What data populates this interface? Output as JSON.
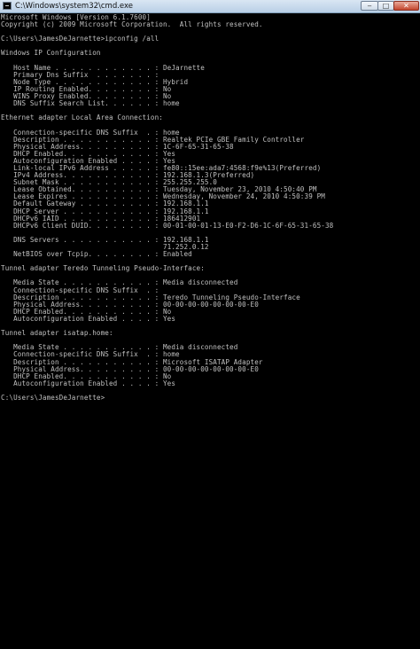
{
  "window": {
    "title": "C:\\Windows\\system32\\cmd.exe",
    "minimize_glyph": "‒",
    "maximize_glyph": "□",
    "close_glyph": "✕",
    "icon": "cmd-icon",
    "colors": {
      "background": "#000000",
      "text": "#c0c0c0",
      "close_button": "#c4472f"
    }
  },
  "console": {
    "lines": [
      "Microsoft Windows [Version 6.1.7600]",
      "Copyright (c) 2009 Microsoft Corporation.  All rights reserved.",
      "",
      "C:\\Users\\JamesDeJarnette>ipconfig /all",
      "",
      "Windows IP Configuration",
      "",
      "   Host Name . . . . . . . . . . . . : DeJarnette",
      "   Primary Dns Suffix  . . . . . . . :",
      "   Node Type . . . . . . . . . . . . : Hybrid",
      "   IP Routing Enabled. . . . . . . . : No",
      "   WINS Proxy Enabled. . . . . . . . : No",
      "   DNS Suffix Search List. . . . . . : home",
      "",
      "Ethernet adapter Local Area Connection:",
      "",
      "   Connection-specific DNS Suffix  . : home",
      "   Description . . . . . . . . . . . : Realtek PCIe GBE Family Controller",
      "   Physical Address. . . . . . . . . : 1C-6F-65-31-65-38",
      "   DHCP Enabled. . . . . . . . . . . : Yes",
      "   Autoconfiguration Enabled . . . . : Yes",
      "   Link-local IPv6 Address . . . . . : fe80::15ee:ada7:4568:f9e%13(Preferred)",
      "   IPv4 Address. . . . . . . . . . . : 192.168.1.3(Preferred)",
      "   Subnet Mask . . . . . . . . . . . : 255.255.255.0",
      "   Lease Obtained. . . . . . . . . . : Tuesday, November 23, 2010 4:50:40 PM",
      "   Lease Expires . . . . . . . . . . : Wednesday, November 24, 2010 4:50:39 PM",
      "   Default Gateway . . . . . . . . . : 192.168.1.1",
      "   DHCP Server . . . . . . . . . . . : 192.168.1.1",
      "   DHCPv6 IAID . . . . . . . . . . . : 186412901",
      "   DHCPv6 Client DUID. . . . . . . . : 00-01-00-01-13-E0-F2-D6-1C-6F-65-31-65-38",
      "",
      "   DNS Servers . . . . . . . . . . . : 192.168.1.1",
      "                                       71.252.0.12",
      "   NetBIOS over Tcpip. . . . . . . . : Enabled",
      "",
      "Tunnel adapter Teredo Tunneling Pseudo-Interface:",
      "",
      "   Media State . . . . . . . . . . . : Media disconnected",
      "   Connection-specific DNS Suffix  . :",
      "   Description . . . . . . . . . . . : Teredo Tunneling Pseudo-Interface",
      "   Physical Address. . . . . . . . . : 00-00-00-00-00-00-00-E0",
      "   DHCP Enabled. . . . . . . . . . . : No",
      "   Autoconfiguration Enabled . . . . : Yes",
      "",
      "Tunnel adapter isatap.home:",
      "",
      "   Media State . . . . . . . . . . . : Media disconnected",
      "   Connection-specific DNS Suffix  . : home",
      "   Description . . . . . . . . . . . : Microsoft ISATAP Adapter",
      "   Physical Address. . . . . . . . . : 00-00-00-00-00-00-00-E0",
      "   DHCP Enabled. . . . . . . . . . . : No",
      "   Autoconfiguration Enabled . . . . : Yes",
      "",
      "C:\\Users\\JamesDeJarnette>"
    ]
  }
}
